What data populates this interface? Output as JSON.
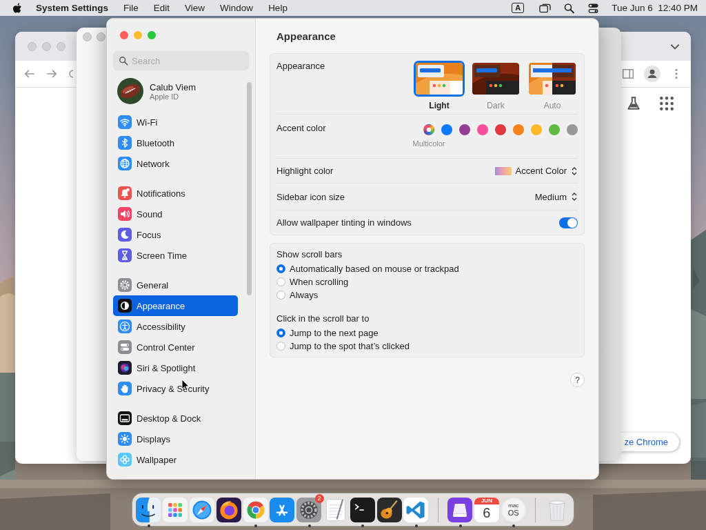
{
  "menubar": {
    "app": "System Settings",
    "menus": [
      "File",
      "Edit",
      "View",
      "Window",
      "Help"
    ],
    "input_source": "A",
    "clock": "Tue Jun 6  12:40 PM"
  },
  "browser_window": {
    "button": "ze Chrome"
  },
  "settings": {
    "search": {
      "placeholder": "Search"
    },
    "account": {
      "name": "Calub Viem",
      "subtitle": "Apple ID"
    },
    "sidebar_groups": [
      [
        {
          "label": "Wi-Fi",
          "kind": "wifi",
          "selected": false
        },
        {
          "label": "Bluetooth",
          "kind": "bluetooth",
          "selected": false
        },
        {
          "label": "Network",
          "kind": "network",
          "selected": false
        }
      ],
      [
        {
          "label": "Notifications",
          "kind": "notifications",
          "selected": false
        },
        {
          "label": "Sound",
          "kind": "sound",
          "selected": false
        },
        {
          "label": "Focus",
          "kind": "focus",
          "selected": false
        },
        {
          "label": "Screen Time",
          "kind": "screentime",
          "selected": false
        }
      ],
      [
        {
          "label": "General",
          "kind": "general",
          "selected": false
        },
        {
          "label": "Appearance",
          "kind": "appearance",
          "selected": true
        },
        {
          "label": "Accessibility",
          "kind": "accessibility",
          "selected": false
        },
        {
          "label": "Control Center",
          "kind": "controlcenter",
          "selected": false
        },
        {
          "label": "Siri & Spotlight",
          "kind": "siri",
          "selected": false
        },
        {
          "label": "Privacy & Security",
          "kind": "privacy",
          "selected": false
        }
      ],
      [
        {
          "label": "Desktop & Dock",
          "kind": "desktop",
          "selected": false
        },
        {
          "label": "Displays",
          "kind": "displays",
          "selected": false
        },
        {
          "label": "Wallpaper",
          "kind": "wallpaper",
          "selected": false
        }
      ]
    ],
    "title": "Appearance",
    "appearance": {
      "label": "Appearance",
      "options": [
        {
          "label": "Light",
          "kind": "light",
          "selected": true
        },
        {
          "label": "Dark",
          "kind": "dark",
          "selected": false
        },
        {
          "label": "Auto",
          "kind": "auto",
          "selected": false
        }
      ]
    },
    "accent": {
      "label": "Accent color",
      "caption": "Multicolor",
      "colors": [
        {
          "kind": "multicolor",
          "selected": true
        },
        {
          "kind": "solid",
          "color": "#0a7aff",
          "selected": false
        },
        {
          "kind": "solid",
          "color": "#953d96",
          "selected": false
        },
        {
          "kind": "solid",
          "color": "#f74f9e",
          "selected": false
        },
        {
          "kind": "solid",
          "color": "#e0383e",
          "selected": false
        },
        {
          "kind": "solid",
          "color": "#f7821b",
          "selected": false
        },
        {
          "kind": "solid",
          "color": "#fcb827",
          "selected": false
        },
        {
          "kind": "solid",
          "color": "#62ba46",
          "selected": false
        },
        {
          "kind": "solid",
          "color": "#989898",
          "selected": false
        }
      ]
    },
    "highlight": {
      "label": "Highlight color",
      "value": "Accent Color"
    },
    "icon_size": {
      "label": "Sidebar icon size",
      "value": "Medium"
    },
    "tinting": {
      "label": "Allow wallpaper tinting in windows",
      "on": true
    },
    "scroll_bars": {
      "label": "Show scroll bars",
      "options": [
        {
          "label": "Automatically based on mouse or trackpad",
          "selected": true
        },
        {
          "label": "When scrolling",
          "selected": false
        },
        {
          "label": "Always",
          "selected": false
        }
      ]
    },
    "click_scroll": {
      "label": "Click in the scroll bar to",
      "options": [
        {
          "label": "Jump to the next page",
          "selected": true
        },
        {
          "label": "Jump to the spot that’s clicked",
          "selected": false
        }
      ]
    },
    "help": "?"
  },
  "dock": {
    "items": [
      {
        "kind": "finder",
        "running": true
      },
      {
        "kind": "launchpad",
        "running": false
      },
      {
        "kind": "safari",
        "running": false
      },
      {
        "kind": "firefox",
        "running": false
      },
      {
        "kind": "chrome",
        "running": true
      },
      {
        "kind": "appstore",
        "running": false
      },
      {
        "kind": "settings",
        "running": true,
        "badge": "2"
      },
      {
        "kind": "textedit",
        "running": false
      },
      {
        "kind": "terminal",
        "running": true
      },
      {
        "kind": "garageband",
        "running": false
      },
      {
        "kind": "vscode",
        "running": true
      },
      {
        "kind": "divider"
      },
      {
        "kind": "drive",
        "running": true
      },
      {
        "kind": "calendar",
        "running": false,
        "texts": [
          "JUN",
          "6"
        ]
      },
      {
        "kind": "installer",
        "running": true,
        "texts": [
          "mac",
          "OS"
        ]
      },
      {
        "kind": "divider"
      },
      {
        "kind": "trash",
        "running": false
      }
    ]
  }
}
